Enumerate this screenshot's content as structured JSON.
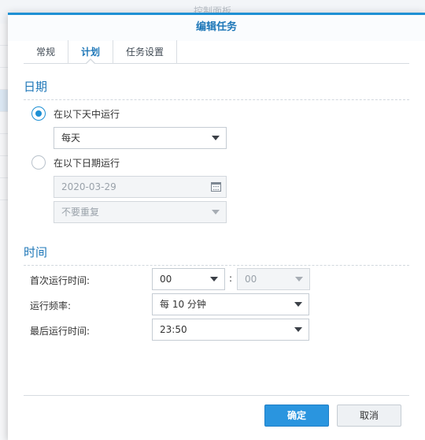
{
  "background": {
    "window_title": "控制面板"
  },
  "dialog": {
    "title": "编辑任务",
    "tabs": [
      {
        "label": "常规",
        "active": false
      },
      {
        "label": "计划",
        "active": true
      },
      {
        "label": "任务设置",
        "active": false
      }
    ]
  },
  "date_section": {
    "title": "日期",
    "option_daily": {
      "label": "在以下天中运行",
      "checked": true,
      "selected_value": "每天"
    },
    "option_date": {
      "label": "在以下日期运行",
      "checked": false,
      "date_value": "2020-03-29",
      "repeat_value": "不要重复"
    }
  },
  "time_section": {
    "title": "时间",
    "first_run": {
      "label": "首次运行时间:",
      "hour": "00",
      "separator": ":",
      "minute": "00"
    },
    "frequency": {
      "label": "运行频率:",
      "value": "每 10 分钟"
    },
    "last_run": {
      "label": "最后运行时间:",
      "value": "23:50"
    }
  },
  "footer": {
    "ok_label": "确定",
    "cancel_label": "取消"
  },
  "colors": {
    "accent": "#1e90d4",
    "title_text": "#1e77b8",
    "primary_button": "#2a95df"
  }
}
